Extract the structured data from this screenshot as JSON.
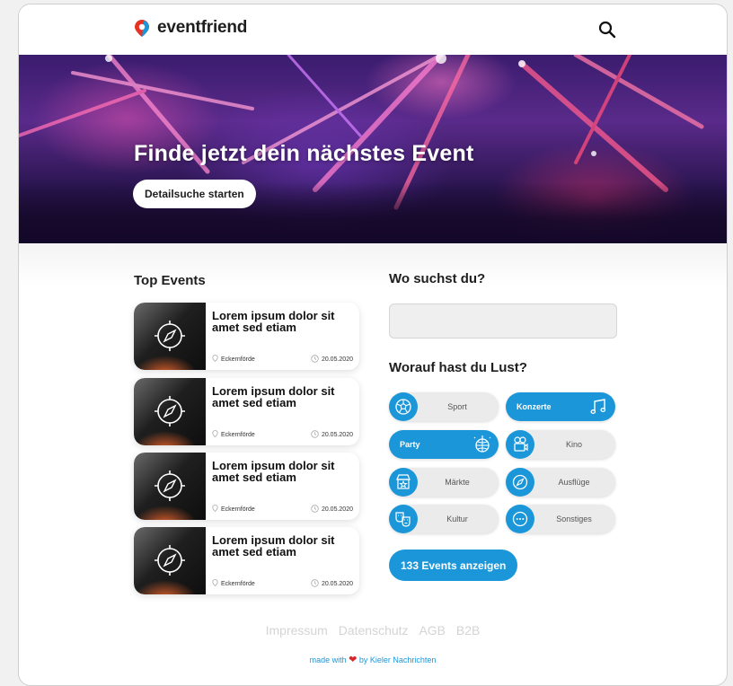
{
  "brand": {
    "name": "eventfriend",
    "accent": "#1b97d9",
    "logo_red": "#e63323",
    "logo_blue": "#1b97d9"
  },
  "header": {
    "search_icon": "search-icon"
  },
  "hero": {
    "title": "Finde jetzt dein nächstes Event",
    "button": "Detailsuche starten"
  },
  "top_events": {
    "heading": "Top Events",
    "items": [
      {
        "title": "Lorem ipsum dolor sit amet sed etiam",
        "location": "Eckernförde",
        "date": "20.05.2020"
      },
      {
        "title": "Lorem ipsum dolor sit amet sed etiam",
        "location": "Eckernförde",
        "date": "20.05.2020"
      },
      {
        "title": "Lorem ipsum dolor sit amet sed etiam",
        "location": "Eckernförde",
        "date": "20.05.2020"
      },
      {
        "title": "Lorem ipsum dolor sit amet sed etiam",
        "location": "Eckernförde",
        "date": "20.05.2020"
      }
    ]
  },
  "where": {
    "heading": "Wo suchst du?",
    "value": "",
    "placeholder": ""
  },
  "categories": {
    "heading": "Worauf hast du Lust?",
    "items": [
      {
        "label": "Sport",
        "icon": "football-icon",
        "active": false
      },
      {
        "label": "Konzerte",
        "icon": "music-notes-icon",
        "active": true
      },
      {
        "label": "Party",
        "icon": "disco-ball-icon",
        "active": true
      },
      {
        "label": "Kino",
        "icon": "film-camera-icon",
        "active": false
      },
      {
        "label": "Märkte",
        "icon": "market-stall-icon",
        "active": false
      },
      {
        "label": "Ausflüge",
        "icon": "compass-icon",
        "active": false
      },
      {
        "label": "Kultur",
        "icon": "theater-masks-icon",
        "active": false
      },
      {
        "label": "Sonstiges",
        "icon": "more-icon",
        "active": false
      }
    ]
  },
  "results_button": "133 Events anzeigen",
  "footer": {
    "links": [
      "Impressum",
      "Datenschutz",
      "AGB",
      "B2B"
    ],
    "made_prefix": "made with",
    "made_suffix": "by Kieler Nachrichten"
  }
}
